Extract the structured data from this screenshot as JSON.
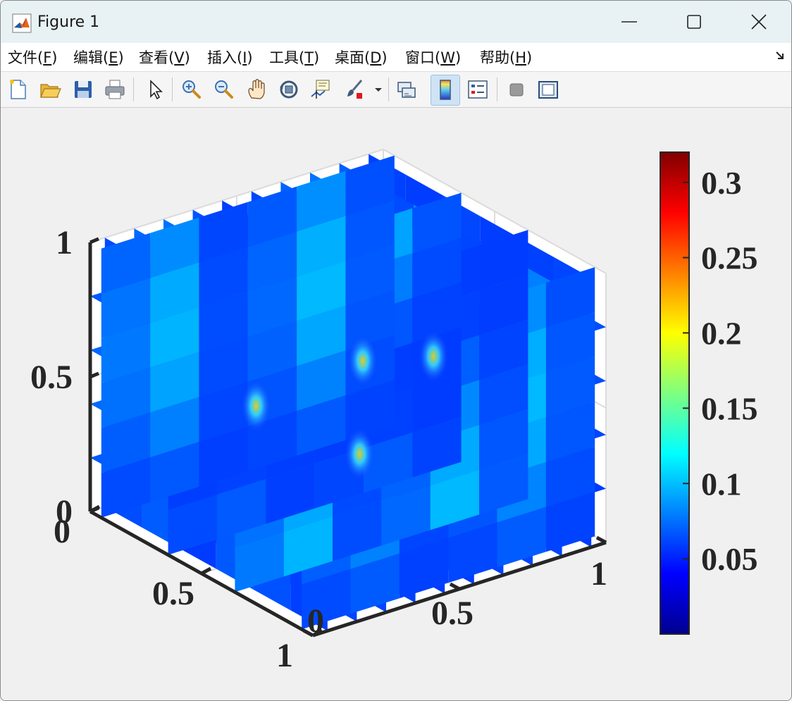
{
  "window": {
    "title": "Figure 1"
  },
  "menu": [
    {
      "label": "文件(F)",
      "mnemonic": "F"
    },
    {
      "label": "编辑(E)",
      "mnemonic": "E"
    },
    {
      "label": "查看(V)",
      "mnemonic": "V"
    },
    {
      "label": "插入(I)",
      "mnemonic": "I"
    },
    {
      "label": "工具(T)",
      "mnemonic": "T"
    },
    {
      "label": "桌面(D)",
      "mnemonic": "D"
    },
    {
      "label": "窗口(W)",
      "mnemonic": "W"
    },
    {
      "label": "帮助(H)",
      "mnemonic": "H"
    }
  ],
  "toolbar": {
    "buttons": [
      "new-figure",
      "open-file",
      "save",
      "print",
      "edit-plot",
      "zoom-in",
      "zoom-out",
      "pan",
      "rotate-3d",
      "data-cursor",
      "brush",
      "brush-menu",
      "link-plot",
      "insert-colorbar",
      "insert-legend",
      "hide-plot-tools",
      "show-plot-tools"
    ],
    "active": "insert-colorbar"
  },
  "chart_data": {
    "type": "heatmap",
    "plot_style": "3d-slice",
    "colormap": "jet",
    "grid": true,
    "box": true,
    "x_axis": {
      "ticks": [
        "0",
        "0.5",
        "1"
      ],
      "lim": [
        0,
        1
      ]
    },
    "y_axis": {
      "ticks": [
        "0",
        "0.5",
        "1"
      ],
      "lim": [
        0,
        1
      ]
    },
    "z_axis": {
      "ticks": [
        "0",
        "0.5",
        "1"
      ],
      "lim": [
        0,
        1
      ]
    },
    "slices": {
      "x": [
        0.05,
        0.15,
        0.25,
        0.35,
        0.45,
        0.55,
        0.65,
        0.75,
        0.85,
        0.95
      ],
      "y": [
        0.05,
        0.35,
        0.65,
        0.95
      ],
      "z": [
        0.2,
        0.4,
        0.6,
        0.8
      ]
    },
    "colorbar": {
      "location": "right",
      "lim": [
        0,
        0.32
      ],
      "ticks": [
        "0.05",
        "0.1",
        "0.15",
        "0.2",
        "0.25",
        "0.3"
      ],
      "tick_values": [
        0.05,
        0.1,
        0.15,
        0.2,
        0.25,
        0.3
      ]
    }
  }
}
